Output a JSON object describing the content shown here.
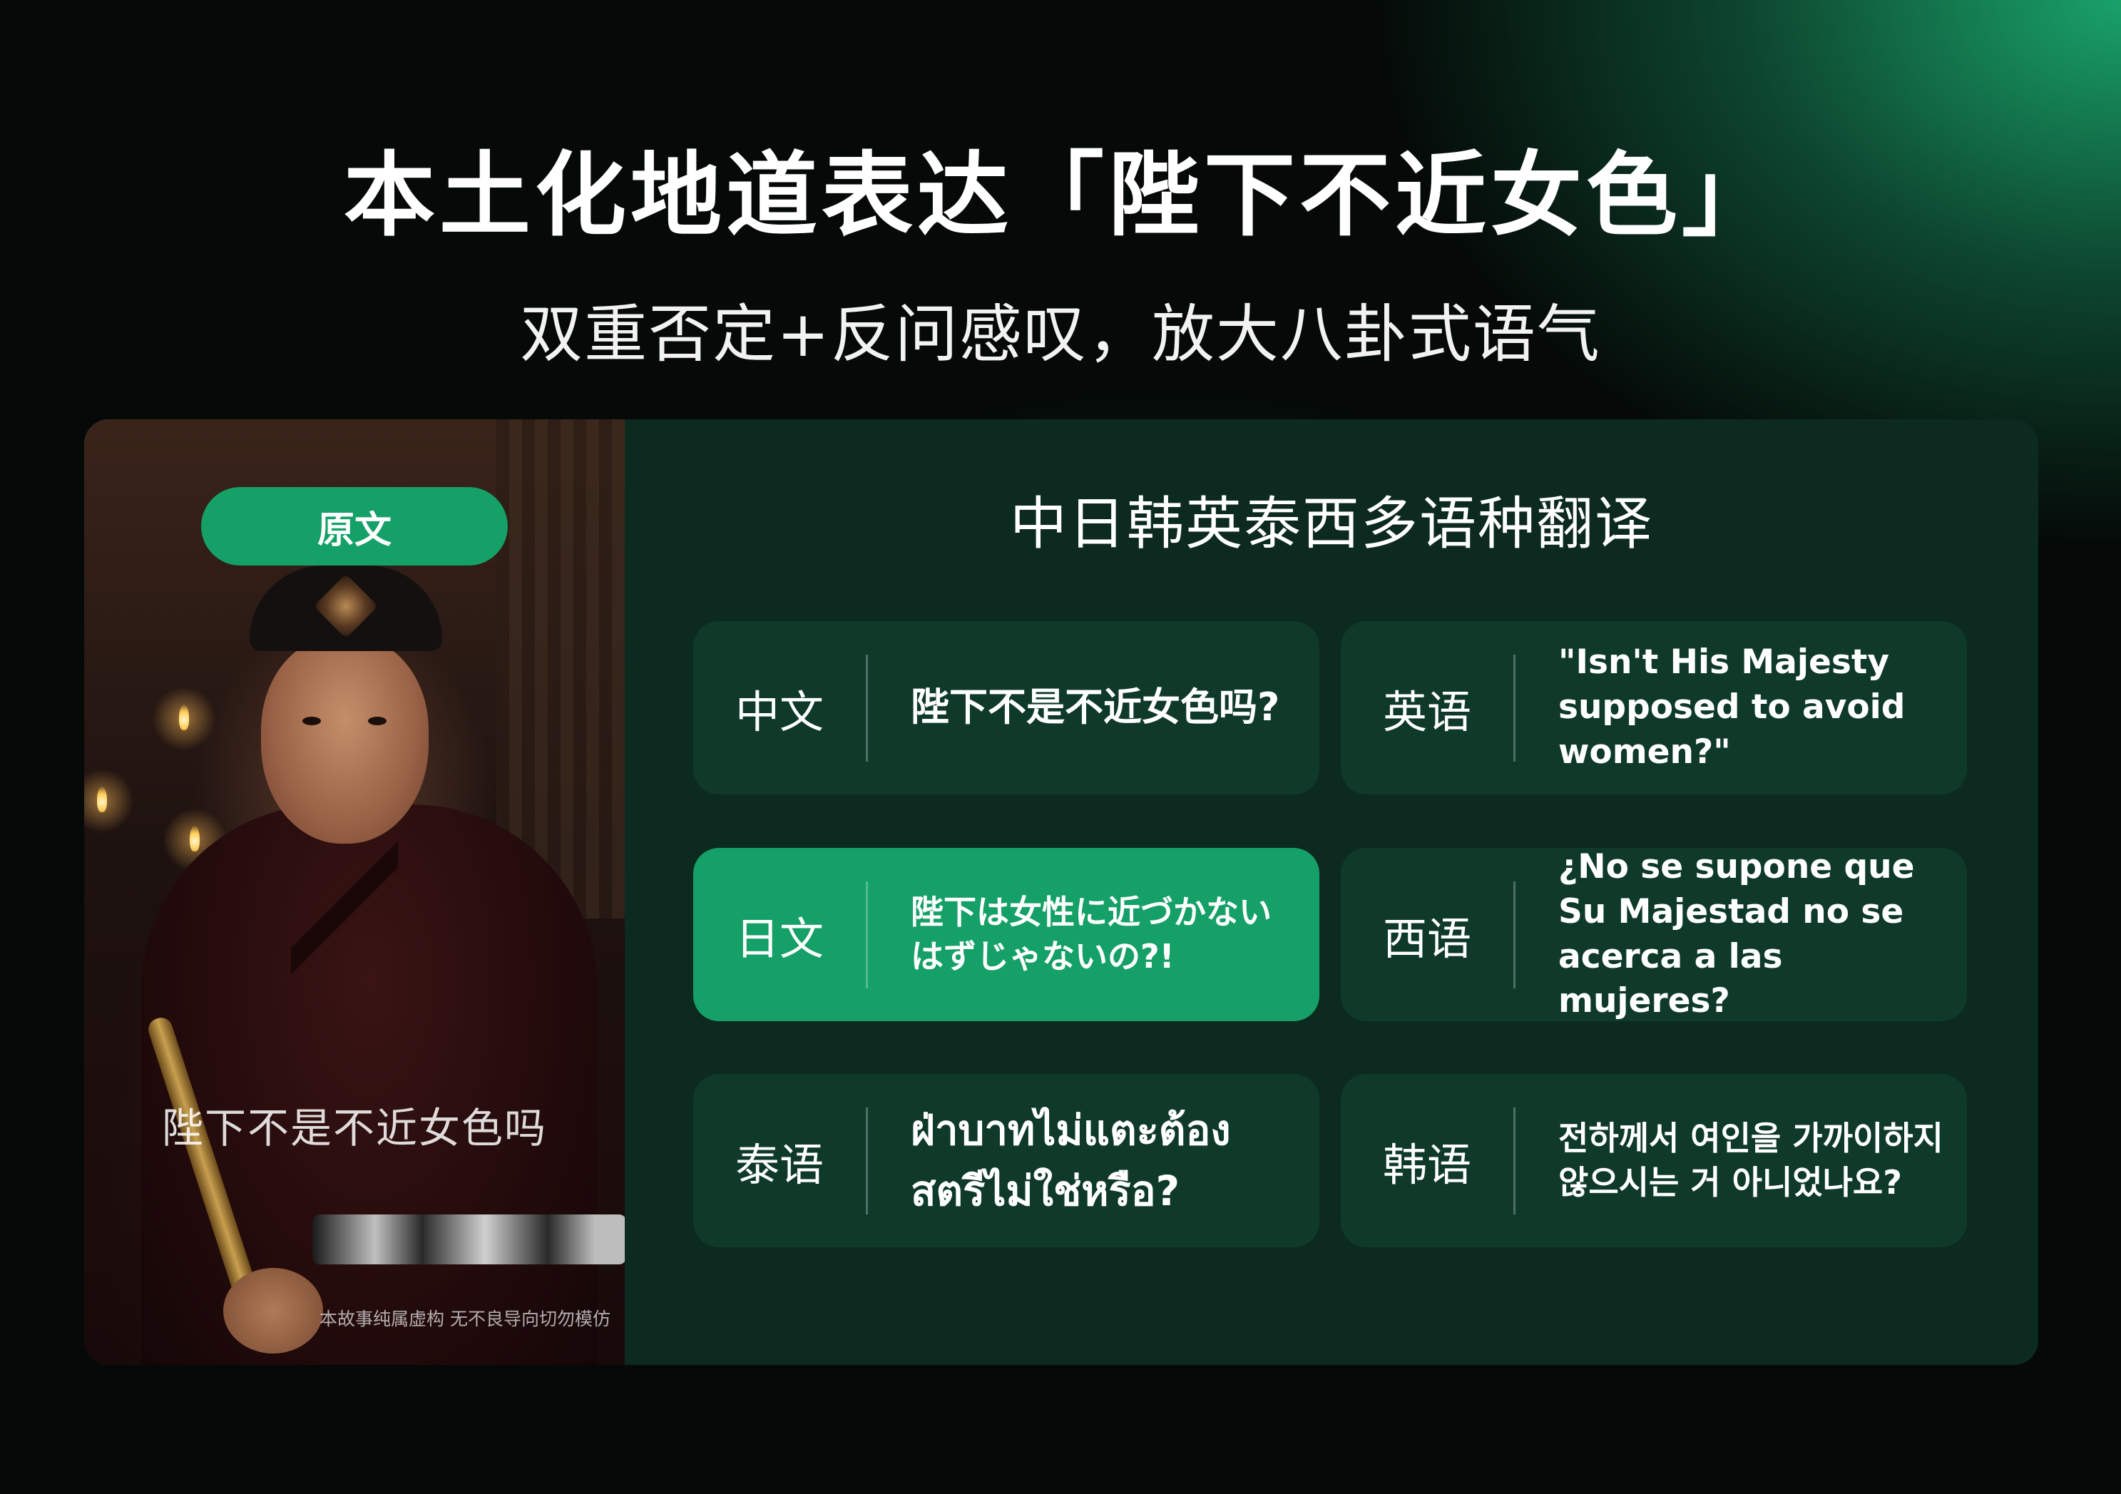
{
  "headline": "本土化地道表达「陛下不近女色」",
  "subheadline": "双重否定+反问感叹，放大八卦式语气",
  "video": {
    "badge": "原文",
    "subtitle": "陛下不是不近女色吗",
    "disclaimer": "本故事纯属虚构 无不良导向切勿模仿"
  },
  "section_title": "中日韩英泰西多语种翻译",
  "translations": [
    {
      "lang": "中文",
      "text": "陛下不是不近女色吗?"
    },
    {
      "lang": "英语",
      "text": "\"Isn't His Majesty supposed to avoid women?\""
    },
    {
      "lang": "日文",
      "text": "陛下は女性に近づかないはずじゃないの?!"
    },
    {
      "lang": "西语",
      "text": "¿No se supone que Su Majestad no se acerca a las mujeres?"
    },
    {
      "lang": "泰语",
      "text": "ฝ่าบาทไม่แตะต้องสตรีไม่ใช่หรือ?"
    },
    {
      "lang": "韩语",
      "text": "전하께서 여인을 가까이하지 않으시는 거 아니었나요?"
    }
  ],
  "colors": {
    "accent": "#15a067",
    "card": "#0f3a2a",
    "panel": "#0d2a20"
  }
}
